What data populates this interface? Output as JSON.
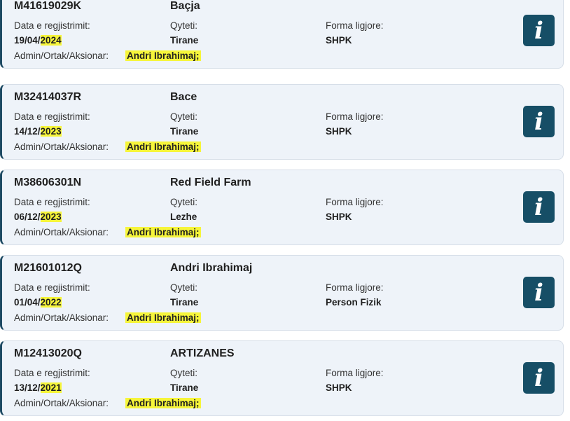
{
  "labels": {
    "registration_date": "Data e regjistrimit:",
    "city": "Qyteti:",
    "legal_form": "Forma ligjore:",
    "admin": "Admin/Ortak/Aksionar:"
  },
  "info_icon_glyph": "i",
  "colors": {
    "accent": "#164e66",
    "highlight": "#f6f53a",
    "card_bg": "#eef3f9"
  },
  "records": [
    {
      "nipt": "M41619029K",
      "name": "Baçja",
      "date_prefix": "19/04/",
      "date_year": "2024",
      "city": "Tirane",
      "legal_form": "SHPK",
      "admin": "Andri Ibrahimaj;"
    },
    {
      "nipt": "M32414037R",
      "name": "Bace",
      "date_prefix": "14/12/",
      "date_year": "2023",
      "city": "Tirane",
      "legal_form": "SHPK",
      "admin": "Andri Ibrahimaj;"
    },
    {
      "nipt": "M38606301N",
      "name": "Red Field Farm",
      "date_prefix": "06/12/",
      "date_year": "2023",
      "city": "Lezhe",
      "legal_form": "SHPK",
      "admin": "Andri Ibrahimaj;"
    },
    {
      "nipt": "M21601012Q",
      "name": "Andri Ibrahimaj",
      "date_prefix": "01/04/",
      "date_year": "2022",
      "city": "Tirane",
      "legal_form": "Person Fizik",
      "admin": "Andri Ibrahimaj;"
    },
    {
      "nipt": "M12413020Q",
      "name": "ARTIZANES",
      "date_prefix": "13/12/",
      "date_year": "2021",
      "city": "Tirane",
      "legal_form": "SHPK",
      "admin": "Andri Ibrahimaj;"
    }
  ]
}
